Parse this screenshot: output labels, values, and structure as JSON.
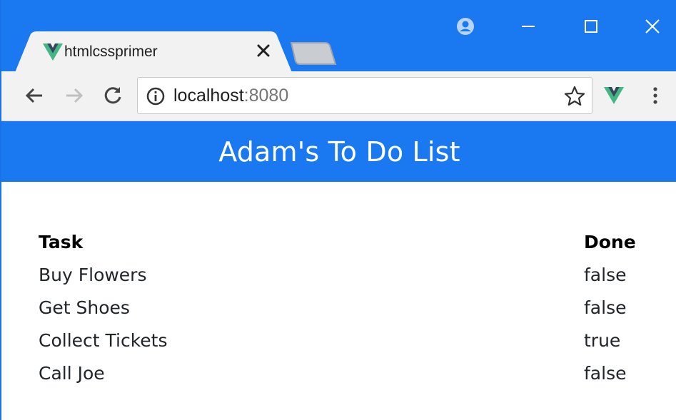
{
  "browser": {
    "tab": {
      "title": "htmlcssprimer",
      "favicon": "vue-logo-icon"
    },
    "address_bar": {
      "host": "localhost",
      "port": ":8080"
    },
    "colors": {
      "frame": "#1a79f0",
      "toolbar": "#f2f2f2",
      "vue_green": "#41b883",
      "vue_dark": "#35495e"
    }
  },
  "page": {
    "title": "Adam's To Do List",
    "header_color": "#1a79f0",
    "table": {
      "headers": [
        "Task",
        "Done"
      ],
      "rows": [
        {
          "task": "Buy Flowers",
          "done": "false"
        },
        {
          "task": "Get Shoes",
          "done": "false"
        },
        {
          "task": "Collect Tickets",
          "done": "true"
        },
        {
          "task": "Call Joe",
          "done": "false"
        }
      ]
    }
  }
}
